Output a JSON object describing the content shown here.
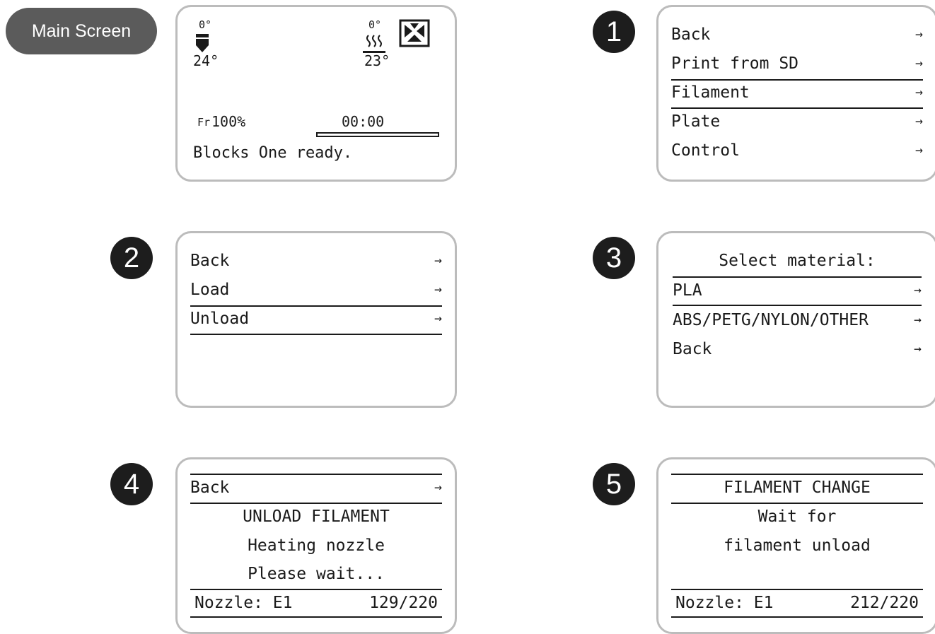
{
  "main_screen": {
    "label": "Main Screen",
    "nozzle_target": "0°",
    "nozzle_current": "24°",
    "bed_target": "0°",
    "bed_current": "23°",
    "feedrate_icon": "Fr",
    "feedrate": "100%",
    "time": "00:00",
    "status": "Blocks One ready.",
    "progress": 0
  },
  "screen1": {
    "step": "1",
    "items": [
      {
        "label": "Back",
        "arrow": "→"
      },
      {
        "label": "Print from SD",
        "arrow": "→"
      },
      {
        "label": "Filament",
        "arrow": "→"
      },
      {
        "label": "Plate",
        "arrow": "→"
      },
      {
        "label": "Control",
        "arrow": "→"
      }
    ]
  },
  "screen2": {
    "step": "2",
    "items": [
      {
        "label": "Back",
        "arrow": "→"
      },
      {
        "label": "Load",
        "arrow": "→"
      },
      {
        "label": "Unload",
        "arrow": "→"
      }
    ]
  },
  "screen3": {
    "step": "3",
    "title": "Select material:",
    "items": [
      {
        "label": "PLA",
        "arrow": "→"
      },
      {
        "label": "ABS/PETG/NYLON/OTHER",
        "arrow": "→"
      },
      {
        "label": "Back",
        "arrow": "→"
      }
    ]
  },
  "screen4": {
    "step": "4",
    "back": {
      "label": "Back",
      "arrow": "→"
    },
    "title": "UNLOAD FILAMENT",
    "line1": "Heating nozzle",
    "line2": "Please wait...",
    "nozzle_label": "Nozzle: E1",
    "nozzle_value": "129/220"
  },
  "screen5": {
    "step": "5",
    "title": "FILAMENT CHANGE",
    "line1": "Wait for",
    "line2": "filament unload",
    "nozzle_label": "Nozzle: E1",
    "nozzle_value": "212/220"
  }
}
